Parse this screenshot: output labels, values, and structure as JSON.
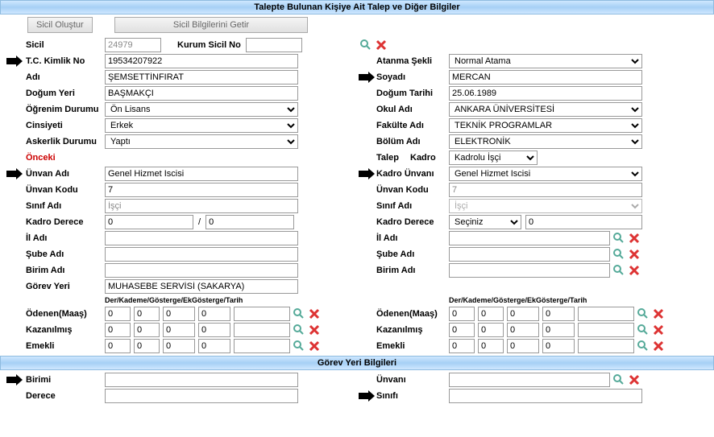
{
  "hdr1": "Talepte Bulunan Kişiye Ait Talep ve Diğer Bilgiler",
  "hdr2": "Görev Yeri Bilgileri",
  "btn": {
    "olustur": "Sicil Oluştur",
    "getir": "Sicil Bilgilerini Getir"
  },
  "L": {
    "sicil": "Sicil",
    "kurum": "Kurum Sicil No",
    "tc": "T.C. Kimlik No",
    "adi": "Adı",
    "dyeri": "Doğum Yeri",
    "ogrenim": "Öğrenim Durumu",
    "cins": "Cinsiyeti",
    "asker": "Askerlik Durumu",
    "onceki": "Önceki",
    "unvanadi": "Ünvan Adı",
    "unvankodu": "Ünvan Kodu",
    "sinif": "Sınıf Adı",
    "kadroder": "Kadro Derece",
    "iladi": "İl Adı",
    "sube": "Şube Adı",
    "birim": "Birim Adı",
    "gorev": "Görev Yeri",
    "sub1": "Der/Kademe/Gösterge/EkGösterge/Tarih",
    "odenen": "Ödenen(Maaş)",
    "kaz": "Kazanılmış",
    "emek": "Emekli",
    "atanma": "Atanma Şekli",
    "soyadi": "Soyadı",
    "dtarih": "Doğum Tarihi",
    "okul": "Okul Adı",
    "fak": "Fakülte Adı",
    "bolum": "Bölüm Adı",
    "talep": "Talep",
    "kadro": "Kadro",
    "kadunvan": "Kadro Ünvanı",
    "birimi": "Birimi",
    "derece": "Derece",
    "unvani": "Ünvanı",
    "sinifi": "Sınıfı"
  },
  "V": {
    "sicil": "24979",
    "tc": "19534207922",
    "adi": "ŞEMSETTİNFIRAT",
    "dyeri": "BAŞMAKÇI",
    "ogrenim": "Ön Lisans",
    "cins": "Erkek",
    "asker": "Yaptı",
    "unvanadi": "Genel Hizmet Iscisi",
    "unvankodu": "7",
    "sinif": "İşçi",
    "kd1": "0",
    "kd2": "0",
    "gorev": "MUHASEBE SERVİSİ (SAKARYA)",
    "atanma": "Normal Atama",
    "soyadi": "MERCAN",
    "dtarih": "25.06.1989",
    "okul": "ANKARA ÜNİVERSİTESİ",
    "fak": "TEKNİK PROGRAMLAR",
    "bolum": "ELEKTRONİK",
    "kadro": "Kadrolu İşçi",
    "kadunvan": "Genel Hizmet Iscisi",
    "unvankodu2": "7",
    "sinif2": "İşçi",
    "secin": "Seçiniz",
    "kd3": "0",
    "o1": "0",
    "o2": "0",
    "o3": "0",
    "o4": "0",
    "o5": "",
    "k1": "0",
    "k2": "0",
    "k3": "0",
    "k4": "0",
    "k5": "",
    "e1": "0",
    "e2": "0",
    "e3": "0",
    "e4": "0",
    "e5": ""
  }
}
